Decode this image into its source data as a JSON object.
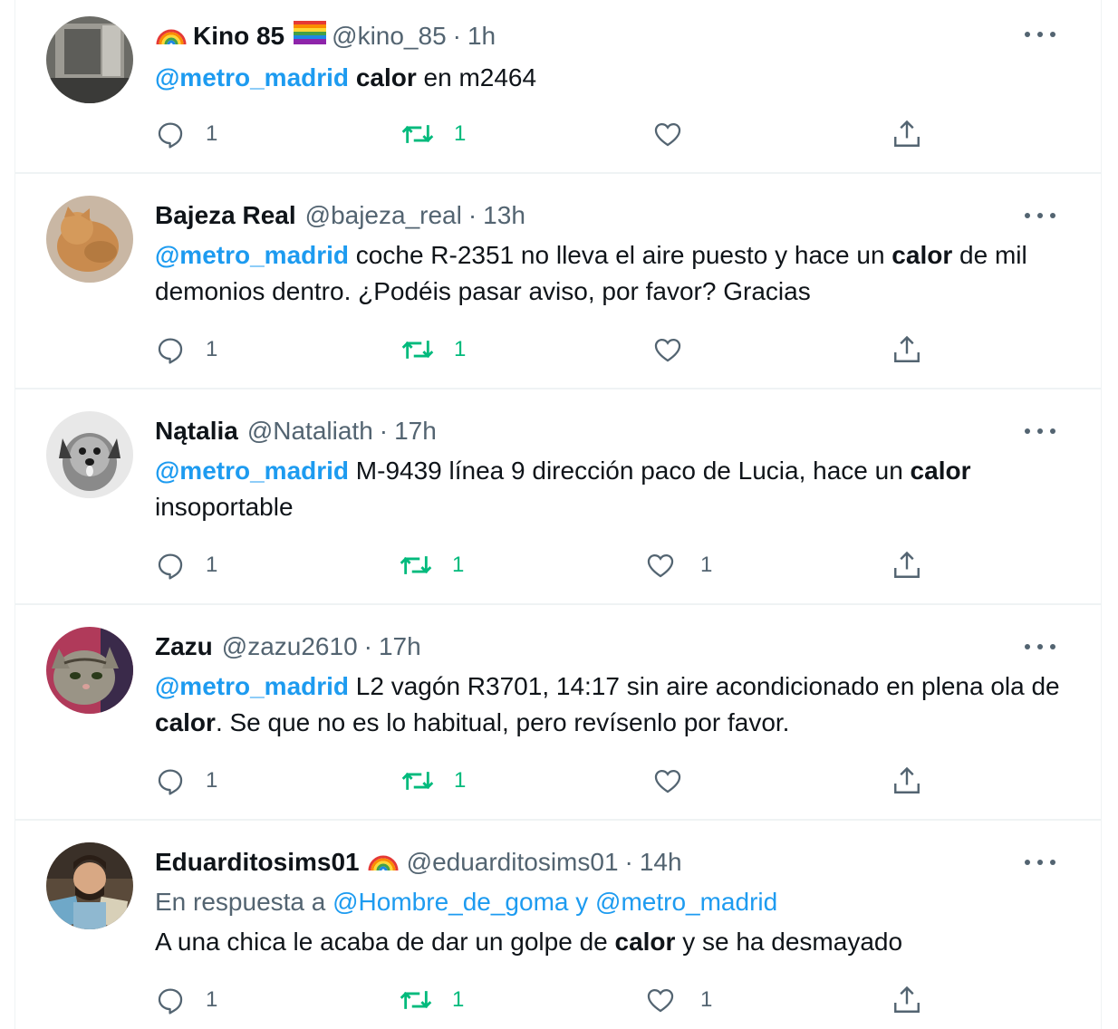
{
  "colors": {
    "accent": "#1d9bf0",
    "retweet": "#00ba7c",
    "secondary": "#536471"
  },
  "tweets": [
    {
      "name": "Kino 85",
      "handle": "@kino_85",
      "time": "1h",
      "emojis": [
        "rainbow-emoji-icon",
        "pride-flag-emoji-icon"
      ],
      "mention": "@metro_madrid",
      "bold": "calor",
      "rest": " en m2464",
      "replies": "1",
      "retweets": "1",
      "likes": ""
    },
    {
      "name": "Bajeza Real",
      "handle": "@bajeza_real",
      "time": "13h",
      "mention": "@metro_madrid",
      "pre": " coche R-2351 no lleva el aire puesto y hace un ",
      "bold": "calor",
      "rest": " de mil demonios dentro. ¿Podéis pasar aviso, por favor? Gracias",
      "replies": "1",
      "retweets": "1",
      "likes": ""
    },
    {
      "name": "Nątalia",
      "handle": "@Nataliath",
      "time": "17h",
      "mention": "@metro_madrid",
      "pre": " M-9439 línea 9 dirección paco de Lucia, hace un ",
      "bold": "calor",
      "rest": " insoportable",
      "replies": "1",
      "retweets": "1",
      "likes": "1"
    },
    {
      "name": "Zazu",
      "handle": "@zazu2610",
      "time": "17h",
      "mention": "@metro_madrid",
      "pre": " L2 vagón R3701, 14:17 sin aire acondicionado en plena ola de ",
      "bold": "calor",
      "rest": ". Se que no es lo habitual, pero revísenlo por favor.",
      "replies": "1",
      "retweets": "1",
      "likes": ""
    },
    {
      "name": "Eduarditosims01",
      "handle": "@eduarditosims01",
      "time": "14h",
      "reply_prefix": "En respuesta a ",
      "reply_user1": "@Hombre_de_goma",
      "reply_and": " y ",
      "reply_user2": "@metro_madrid",
      "pre": "A una chica le acaba de dar un golpe de ",
      "bold": "calor",
      "rest": " y se ha desmayado",
      "replies": "1",
      "retweets": "1",
      "likes": "1"
    }
  ],
  "separator": "·"
}
